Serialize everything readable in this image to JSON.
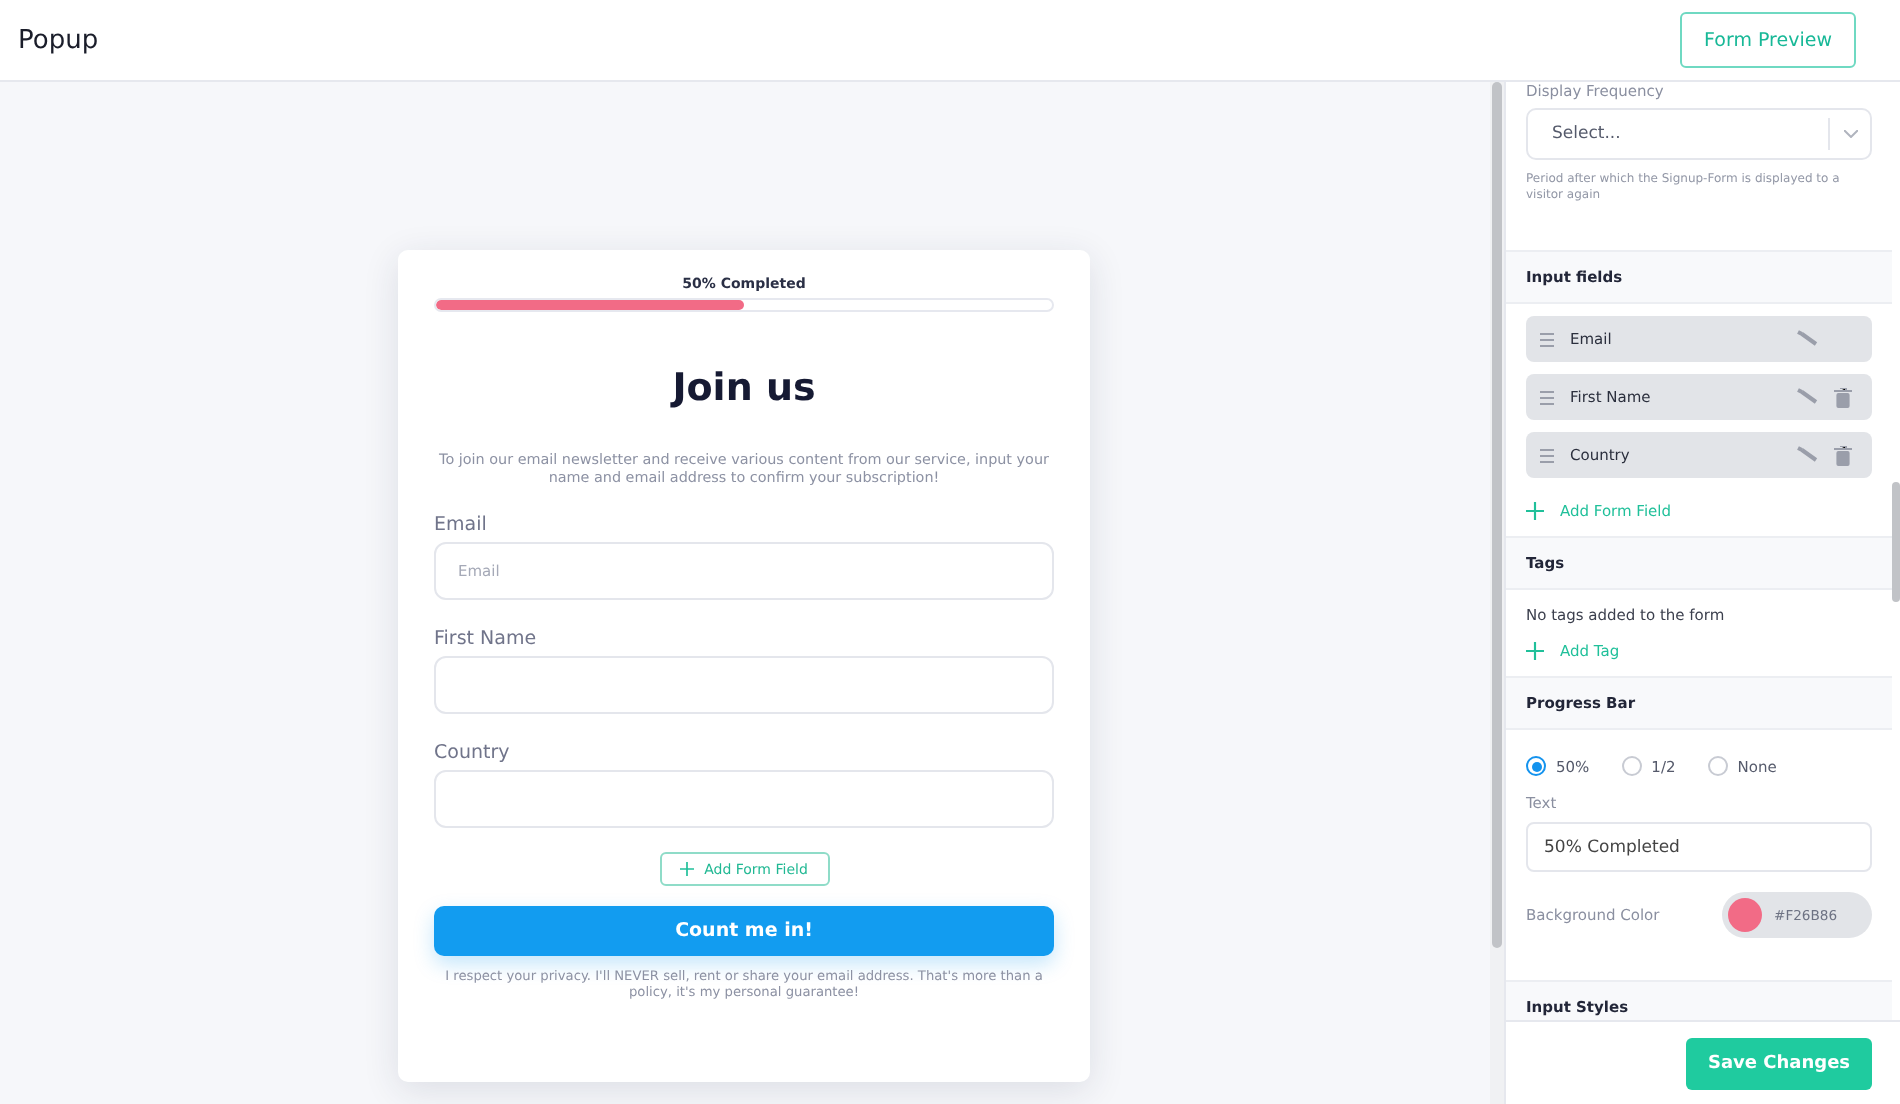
{
  "header": {
    "title": "Popup",
    "preview_button": "Form Preview"
  },
  "form": {
    "progress": {
      "text": "50% Completed",
      "level": 0.5
    },
    "title": "Join us",
    "description": "To join our email newsletter and receive various content from our service, input your name and email address to confirm your subscription!",
    "fields": [
      {
        "label": "Email",
        "placeholder": "Email"
      },
      {
        "label": "First Name"
      },
      {
        "label": "Country"
      }
    ],
    "add_field_button": "Add Form Field",
    "submit_button": "Count me in!",
    "privacy": "I respect your privacy. I'll NEVER sell, rent or share your email address. That's more than a policy, it's my personal guarantee!"
  },
  "settings": {
    "display_frequency": {
      "label": "Display Frequency",
      "placeholder": "Select...",
      "help": "Period after which the Signup-Form is displayed to a visitor again"
    },
    "input_fields": {
      "title": "Input fields",
      "items": [
        {
          "name": "Email",
          "deletable": false
        },
        {
          "name": "First Name",
          "deletable": true
        },
        {
          "name": "Country",
          "deletable": true
        }
      ],
      "add": "Add Form Field"
    },
    "tags": {
      "title": "Tags",
      "empty": "No tags added to the form",
      "add": "Add Tag"
    },
    "progress_bar": {
      "title": "Progress Bar",
      "options": [
        {
          "label": "50%",
          "selected": true
        },
        {
          "label": "1/2",
          "selected": false
        },
        {
          "label": "None",
          "selected": false
        }
      ],
      "text_label": "Text",
      "text_value": "50% Completed",
      "color_label": "Background Color",
      "color_value": "#F26B86",
      "color": "#f26b86"
    },
    "input_styles": {
      "title": "Input Styles"
    }
  },
  "save_button": "Save Changes"
}
